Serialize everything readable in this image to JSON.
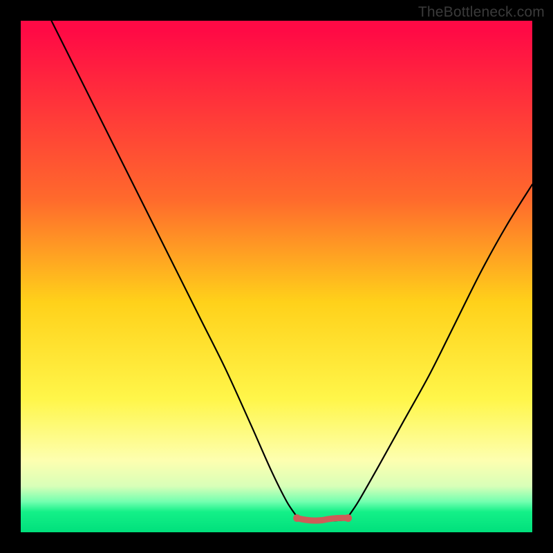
{
  "site_label": "TheBottleneck.com",
  "colors": {
    "frame": "#000000",
    "gradient_top": "#ff0a45",
    "gradient_mid1": "#ff6a2c",
    "gradient_mid2": "#ffd11a",
    "gradient_mid3": "#fff64a",
    "gradient_mid4": "#fdffb0",
    "gradient_mid5": "#d8ffb8",
    "gradient_mid6": "#74ffb0",
    "gradient_bottom": "#00e07c",
    "curve": "#000000",
    "accent_marker": "#cd5d58"
  },
  "chart_data": {
    "type": "line",
    "title": "",
    "xlabel": "",
    "ylabel": "",
    "xlim": [
      0,
      100
    ],
    "ylim": [
      0,
      100
    ],
    "left_branch": [
      {
        "x": 6,
        "y": 100
      },
      {
        "x": 10,
        "y": 92
      },
      {
        "x": 15,
        "y": 82
      },
      {
        "x": 20,
        "y": 72
      },
      {
        "x": 25,
        "y": 62
      },
      {
        "x": 30,
        "y": 52
      },
      {
        "x": 35,
        "y": 42
      },
      {
        "x": 40,
        "y": 32
      },
      {
        "x": 45,
        "y": 21
      },
      {
        "x": 49,
        "y": 12
      },
      {
        "x": 52,
        "y": 6
      },
      {
        "x": 54,
        "y": 3
      }
    ],
    "right_branch": [
      {
        "x": 64,
        "y": 3
      },
      {
        "x": 66,
        "y": 6
      },
      {
        "x": 70,
        "y": 13
      },
      {
        "x": 75,
        "y": 22
      },
      {
        "x": 80,
        "y": 31
      },
      {
        "x": 85,
        "y": 41
      },
      {
        "x": 90,
        "y": 51
      },
      {
        "x": 95,
        "y": 60
      },
      {
        "x": 100,
        "y": 68
      }
    ],
    "flat_segment": {
      "x_start": 54,
      "x_end": 64,
      "y": 2.5
    },
    "marker_region": {
      "x_start": 54,
      "x_end": 64,
      "y": 2.5,
      "color": "#cd5d58"
    }
  }
}
